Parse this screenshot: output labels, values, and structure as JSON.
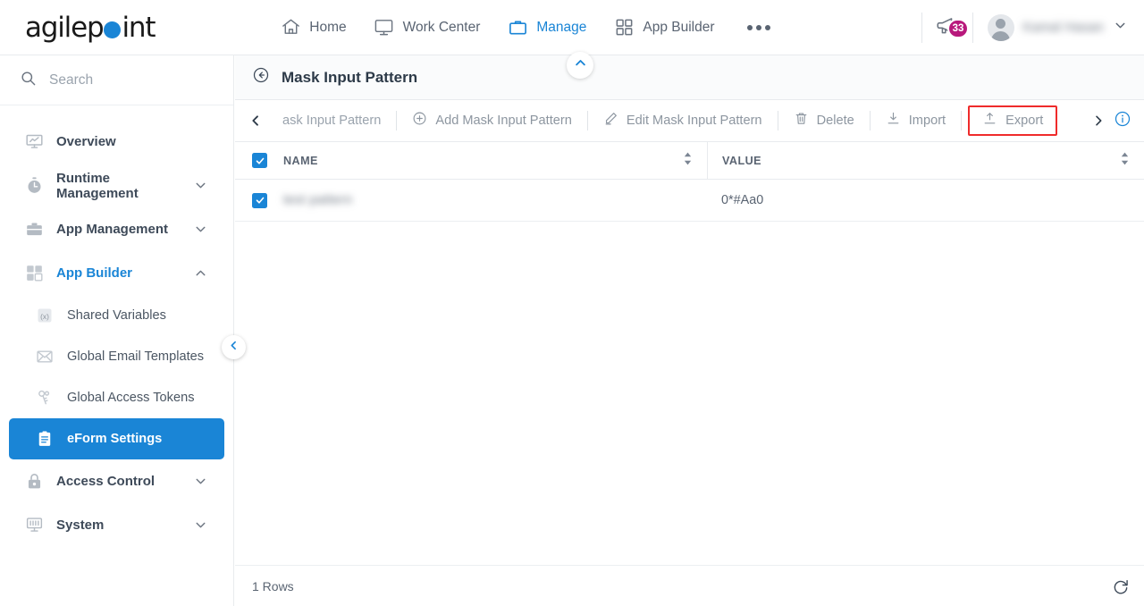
{
  "header": {
    "logo": {
      "prefix": "agilep",
      "dot": "o",
      "suffix": "int"
    },
    "nav": [
      {
        "label": "Home",
        "icon": "home-icon",
        "active": false
      },
      {
        "label": "Work Center",
        "icon": "monitor-icon",
        "active": false
      },
      {
        "label": "Manage",
        "icon": "briefcase-icon",
        "active": true
      },
      {
        "label": "App Builder",
        "icon": "grid-icon",
        "active": false
      }
    ],
    "more_label": "",
    "announcements": {
      "icon": "megaphone-icon",
      "badge": "33"
    },
    "user": {
      "name": "Kamal Hasan",
      "avatar": "avatar-icon",
      "caret": "chevron-down-icon"
    }
  },
  "sidebar": {
    "search": {
      "placeholder": "Search",
      "icon": "search-icon"
    },
    "items": [
      {
        "label": "Overview",
        "icon": "presentation-icon",
        "level": 0,
        "caret": "",
        "state": ""
      },
      {
        "label": "Runtime Management",
        "icon": "stopwatch-icon",
        "level": 0,
        "caret": "down",
        "state": ""
      },
      {
        "label": "App Management",
        "icon": "briefcase-icon",
        "level": 0,
        "caret": "down",
        "state": ""
      },
      {
        "label": "App Builder",
        "icon": "grid-icon",
        "level": 0,
        "caret": "up",
        "state": "open"
      },
      {
        "label": "Shared Variables",
        "icon": "variable-icon",
        "level": 1,
        "caret": "",
        "state": ""
      },
      {
        "label": "Global Email Templates",
        "icon": "envelope-icon",
        "level": 1,
        "caret": "",
        "state": ""
      },
      {
        "label": "Global Access Tokens",
        "icon": "keys-icon",
        "level": 1,
        "caret": "",
        "state": ""
      },
      {
        "label": "eForm Settings",
        "icon": "clipboard-icon",
        "level": 1,
        "caret": "",
        "state": "selected"
      },
      {
        "label": "Access Control",
        "icon": "lock-icon",
        "level": 0,
        "caret": "down",
        "state": ""
      },
      {
        "label": "System",
        "icon": "system-icon",
        "level": 0,
        "caret": "down",
        "state": ""
      }
    ],
    "collapse_icon": "chevron-left-icon"
  },
  "main": {
    "page_title": "Mask Input Pattern",
    "back_icon": "back-circle-icon",
    "top_collapse_icon": "chevron-up-icon",
    "toolbar": {
      "scroll_left_icon": "chevron-left-icon",
      "scroll_right_icon": "chevron-right-icon",
      "info_icon": "info-icon",
      "items": [
        {
          "label": "ask Input Pattern",
          "icon": "",
          "highlight": false
        },
        {
          "label": "Add Mask Input Pattern",
          "icon": "plus-circle-icon",
          "highlight": false
        },
        {
          "label": "Edit Mask Input Pattern",
          "icon": "pencil-icon",
          "highlight": false
        },
        {
          "label": "Delete",
          "icon": "trash-icon",
          "highlight": false
        },
        {
          "label": "Import",
          "icon": "import-icon",
          "highlight": false
        },
        {
          "label": "Export",
          "icon": "export-icon",
          "highlight": true
        }
      ]
    },
    "table": {
      "select_all_checked": true,
      "columns": [
        {
          "label": "NAME",
          "sortable": true
        },
        {
          "label": "VALUE",
          "sortable": true
        }
      ],
      "rows": [
        {
          "checked": true,
          "name": "test pattern",
          "name_redacted": true,
          "value": "0*#Aa0"
        }
      ]
    },
    "footer": {
      "rows_label": "1 Rows",
      "refresh_icon": "refresh-icon"
    }
  },
  "colors": {
    "accent": "#1a85d6",
    "badge": "#b8197c",
    "highlight_border": "#ef2b2b",
    "text": "#3e4a59",
    "muted": "#8d96a0"
  }
}
